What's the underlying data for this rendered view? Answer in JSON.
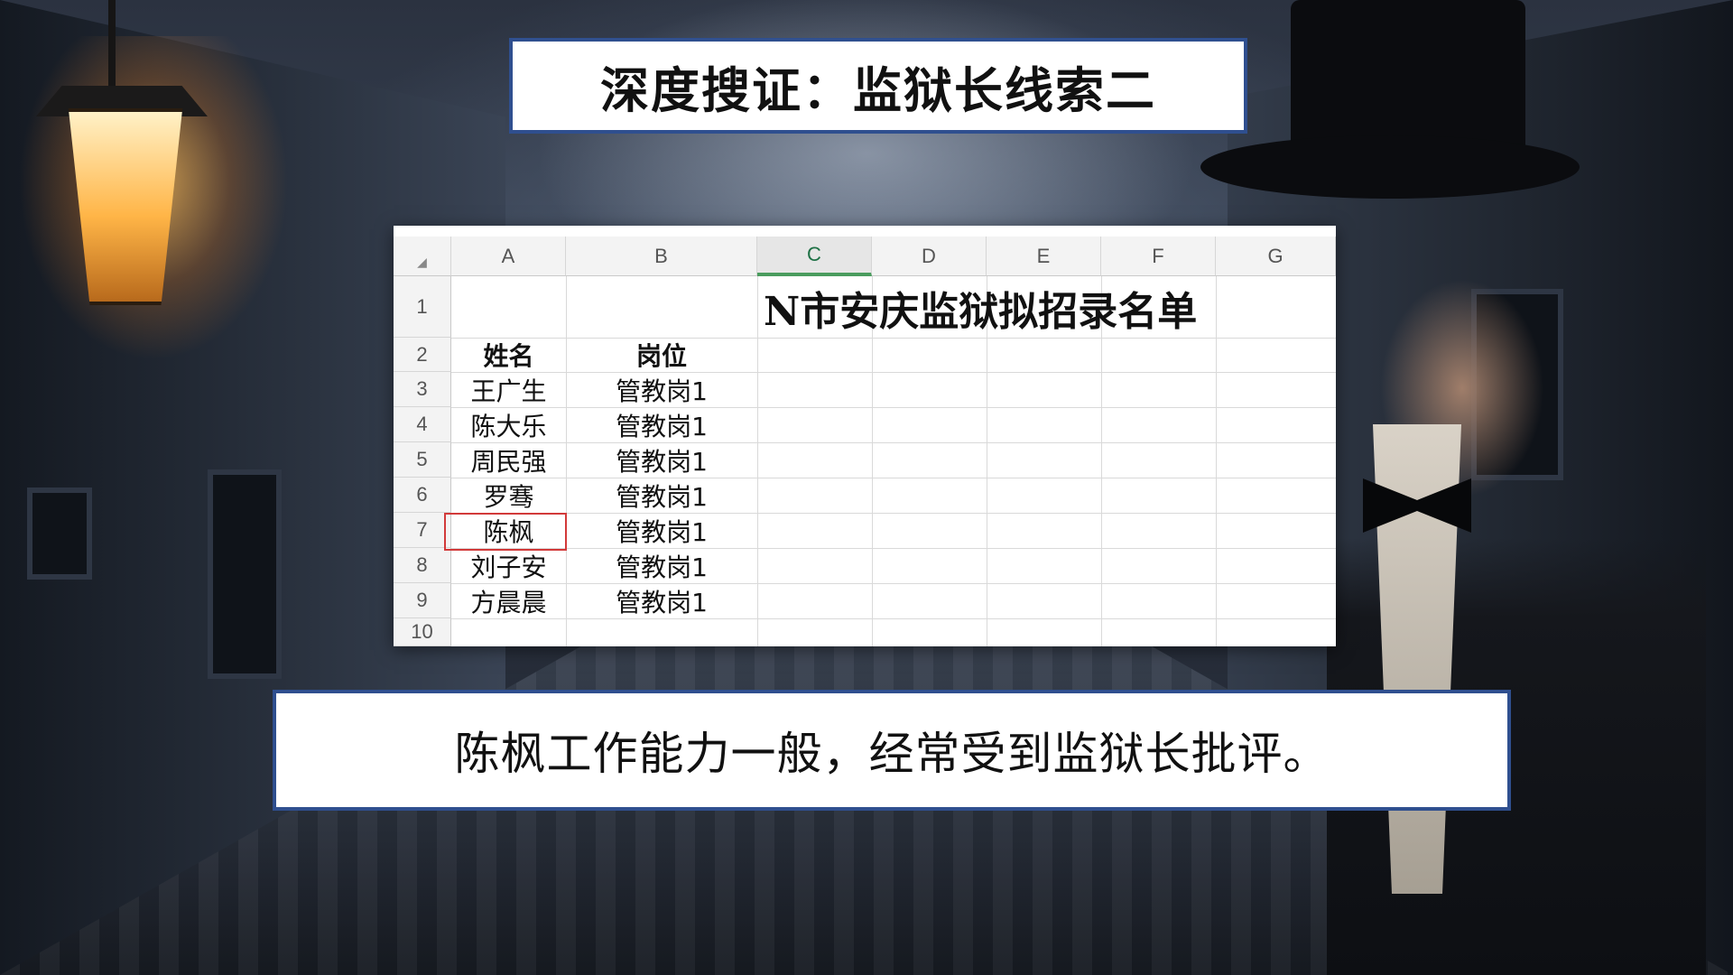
{
  "slide": {
    "title": "深度搜证：监狱长线索二",
    "caption": "陈枫工作能力一般，经常受到监狱长批评。"
  },
  "sheet": {
    "title": "N市安庆监狱拟招录名单",
    "columns": [
      "A",
      "B",
      "C",
      "D",
      "E",
      "F",
      "G"
    ],
    "active_column": "C",
    "rows": [
      "1",
      "2",
      "3",
      "4",
      "5",
      "6",
      "7",
      "8",
      "9",
      "10"
    ],
    "header_name": "姓名",
    "header_post": "岗位",
    "records": [
      {
        "name": "王广生",
        "post": "管教岗1"
      },
      {
        "name": "陈大乐",
        "post": "管教岗1"
      },
      {
        "name": "周民强",
        "post": "管教岗1"
      },
      {
        "name": "罗骞",
        "post": "管教岗1"
      },
      {
        "name": "陈枫",
        "post": "管教岗1"
      },
      {
        "name": "刘子安",
        "post": "管教岗1"
      },
      {
        "name": "方晨晨",
        "post": "管教岗1"
      }
    ],
    "highlighted_name": "陈枫"
  },
  "colors": {
    "border_blue": "#2f4f8f",
    "highlight_red": "#d23a3a",
    "active_col_green": "#4a9c5e"
  }
}
